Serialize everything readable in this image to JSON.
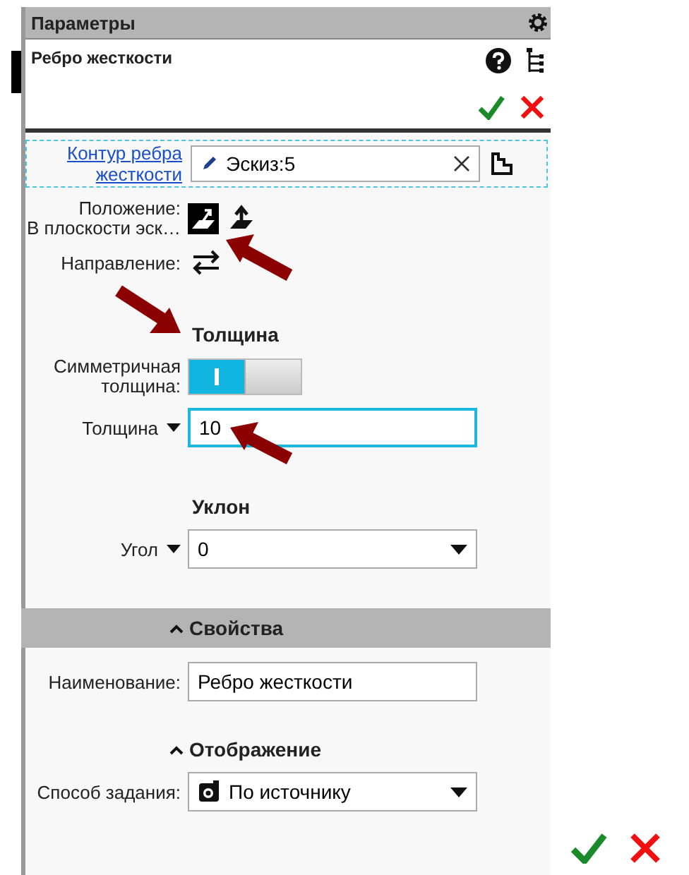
{
  "panel": {
    "title": "Параметры"
  },
  "operation": {
    "title": "Ребро жесткости"
  },
  "rows": [
    {
      "kind": "link-field",
      "label": "Контур ребра жесткости",
      "value": "Эскиз:5"
    },
    {
      "kind": "icon-choice",
      "label": "Положение:",
      "sublabel": "В плоскости эск…",
      "options": [
        {
          "selected": true
        },
        {
          "selected": false
        }
      ]
    },
    {
      "kind": "icon-button",
      "label": "Направление:"
    },
    {
      "kind": "heading",
      "label": "Толщина"
    },
    {
      "kind": "toggle",
      "label": "Симметричная толщина:",
      "on": true
    },
    {
      "kind": "input",
      "label": "Толщина",
      "value": "10",
      "focused": true
    },
    {
      "kind": "heading",
      "label": "Уклон"
    },
    {
      "kind": "dropdown",
      "label": "Угол",
      "value": "0"
    },
    {
      "kind": "section",
      "label": "Свойства",
      "expanded": true
    },
    {
      "kind": "text-field",
      "label": "Наименование:",
      "value": "Ребро жесткости"
    },
    {
      "kind": "subsection",
      "label": "Отображение",
      "expanded": true
    },
    {
      "kind": "icon-dropdown",
      "label": "Способ задания:",
      "value": "По источнику"
    }
  ]
}
